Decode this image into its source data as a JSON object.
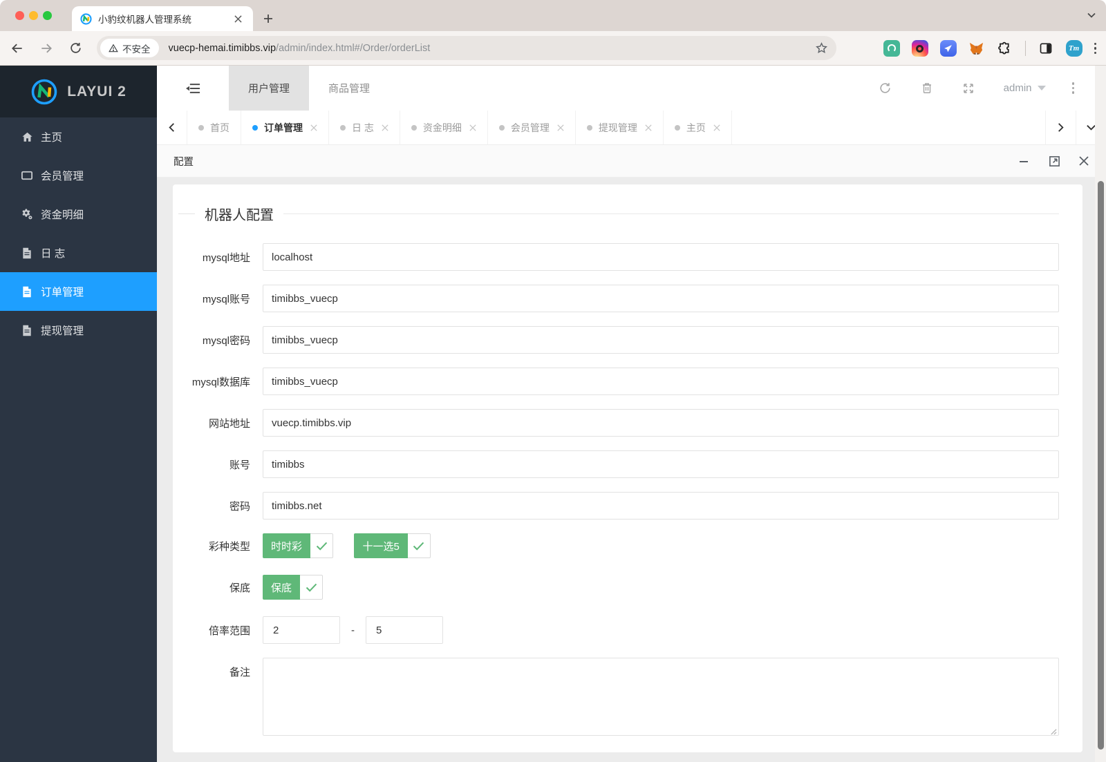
{
  "browser": {
    "tab_title": "小豹纹机器人管理系统",
    "security_label": "不安全",
    "url_host": "vuecp-hemai.timibbs.vip",
    "url_path": "/admin/index.html#/Order/orderList",
    "extension_badge": "Tm"
  },
  "sidebar": {
    "logo_text": "LAYUI 2",
    "items": [
      {
        "label": "主页",
        "icon": "home-icon"
      },
      {
        "label": "会员管理",
        "icon": "window-icon"
      },
      {
        "label": "资金明细",
        "icon": "gears-icon"
      },
      {
        "label": "日 志",
        "icon": "file-icon"
      },
      {
        "label": "订单管理",
        "icon": "file-icon",
        "active": true
      },
      {
        "label": "提现管理",
        "icon": "file-icon"
      }
    ]
  },
  "header": {
    "nav": [
      {
        "label": "用户管理",
        "active": true
      },
      {
        "label": "商品管理",
        "active": false
      }
    ],
    "user": "admin"
  },
  "tabs": [
    {
      "label": "首页",
      "active": false,
      "closable": false
    },
    {
      "label": "订单管理",
      "active": true,
      "closable": true
    },
    {
      "label": "日 志",
      "active": false,
      "closable": true
    },
    {
      "label": "资金明细",
      "active": false,
      "closable": true
    },
    {
      "label": "会员管理",
      "active": false,
      "closable": true
    },
    {
      "label": "提现管理",
      "active": false,
      "closable": true
    },
    {
      "label": "主页",
      "active": false,
      "closable": true
    }
  ],
  "panel": {
    "title": "配置"
  },
  "form": {
    "legend": "机器人配置",
    "fields": [
      {
        "label": "mysql地址",
        "value": "localhost"
      },
      {
        "label": "mysql账号",
        "value": "timibbs_vuecp"
      },
      {
        "label": "mysql密码",
        "value": "timibbs_vuecp"
      },
      {
        "label": "mysql数据库",
        "value": "timibbs_vuecp"
      },
      {
        "label": "网站地址",
        "value": "vuecp.timibbs.vip"
      },
      {
        "label": "账号",
        "value": "timibbs"
      },
      {
        "label": "密码",
        "value": "timibbs.net"
      }
    ],
    "checkbox_rows": [
      {
        "label": "彩种类型",
        "options": [
          "时时彩",
          "十一选5"
        ]
      },
      {
        "label": "保底",
        "options": [
          "保底"
        ]
      }
    ],
    "range": {
      "label": "倍率范围",
      "min": "2",
      "max": "5",
      "separator": "-"
    },
    "note_label": "备注",
    "note_value": ""
  },
  "colors": {
    "accent": "#1E9FFF",
    "green": "#5FB878",
    "sidebar": "#2b3543"
  }
}
